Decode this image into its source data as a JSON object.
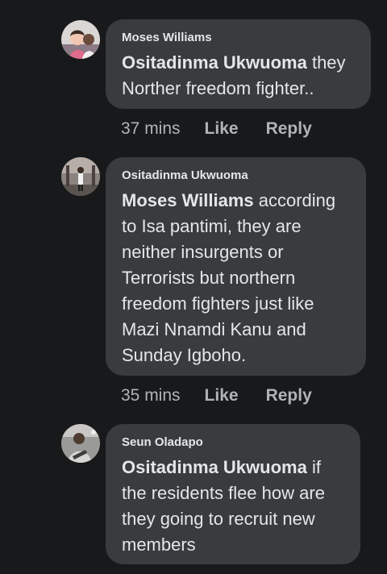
{
  "comments": [
    {
      "author": "Moses Williams",
      "mention": "Ositadinma Ukwuoma",
      "text": " they Norther freedom fighter..",
      "time": "37 mins",
      "like": "Like",
      "reply": "Reply",
      "avatar_icon": "profile-photo-icon"
    },
    {
      "author": "Ositadinma Ukwuoma",
      "mention": "Moses Williams",
      "text": " according to Isa pantimi, they are neither insurgents or Terrorists but northern freedom fighters just like Mazi Nnamdi Kanu and Sunday Igboho.",
      "time": "35 mins",
      "like": "Like",
      "reply": "Reply",
      "avatar_icon": "profile-photo-icon"
    },
    {
      "author": "Seun Oladapo",
      "mention": "Ositadinma Ukwuoma",
      "text": " if the residents flee how are they going to recruit new members",
      "avatar_icon": "profile-photo-icon"
    }
  ],
  "colors": {
    "background": "#18191a",
    "bubble": "#3a3b3c",
    "text": "#e4e6eb",
    "meta": "#b0b3b8"
  }
}
